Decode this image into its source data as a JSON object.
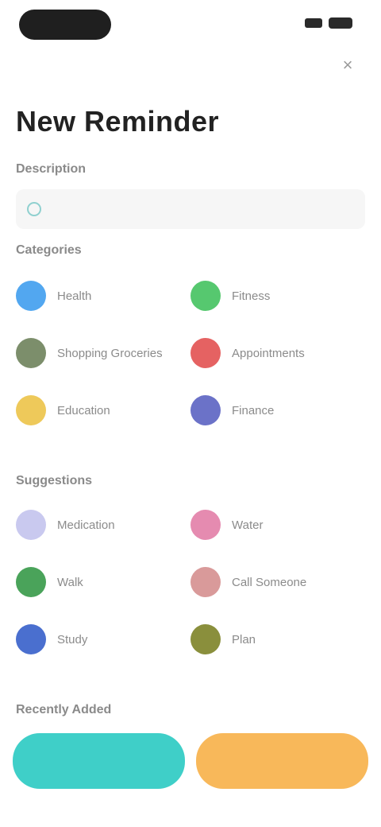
{
  "status_bar": {
    "colors": {
      "pill": "#1f1f1f"
    }
  },
  "header": {
    "title": "New Reminder",
    "close_icon": "close-icon"
  },
  "search": {
    "section_label": "Description",
    "placeholder": "",
    "icon": "search-icon"
  },
  "sections": [
    {
      "label": "Categories",
      "items": [
        {
          "label": "Health",
          "color": "#52a7f0"
        },
        {
          "label": "Fitness",
          "color": "#56c86f"
        },
        {
          "label": "Shopping Groceries",
          "color": "#7c8e6b"
        },
        {
          "label": "Appointments",
          "color": "#e56262"
        },
        {
          "label": "Education",
          "color": "#eec95a"
        },
        {
          "label": "Finance",
          "color": "#6b72c8"
        }
      ]
    },
    {
      "label": "Suggestions",
      "items": [
        {
          "label": "Medication",
          "color": "#c9c9ef"
        },
        {
          "label": "Water",
          "color": "#e58bb0"
        },
        {
          "label": "Walk",
          "color": "#4aa35a"
        },
        {
          "label": "Call Someone",
          "color": "#d99a9a"
        },
        {
          "label": "Study",
          "color": "#4a6fcf"
        },
        {
          "label": "Plan",
          "color": "#8a8f3c"
        }
      ]
    }
  ],
  "footer_label": "Recently Added",
  "actions": {
    "primary": "",
    "secondary": ""
  },
  "colors": {
    "primary": "#3fcfc8",
    "secondary": "#f8b85a"
  }
}
